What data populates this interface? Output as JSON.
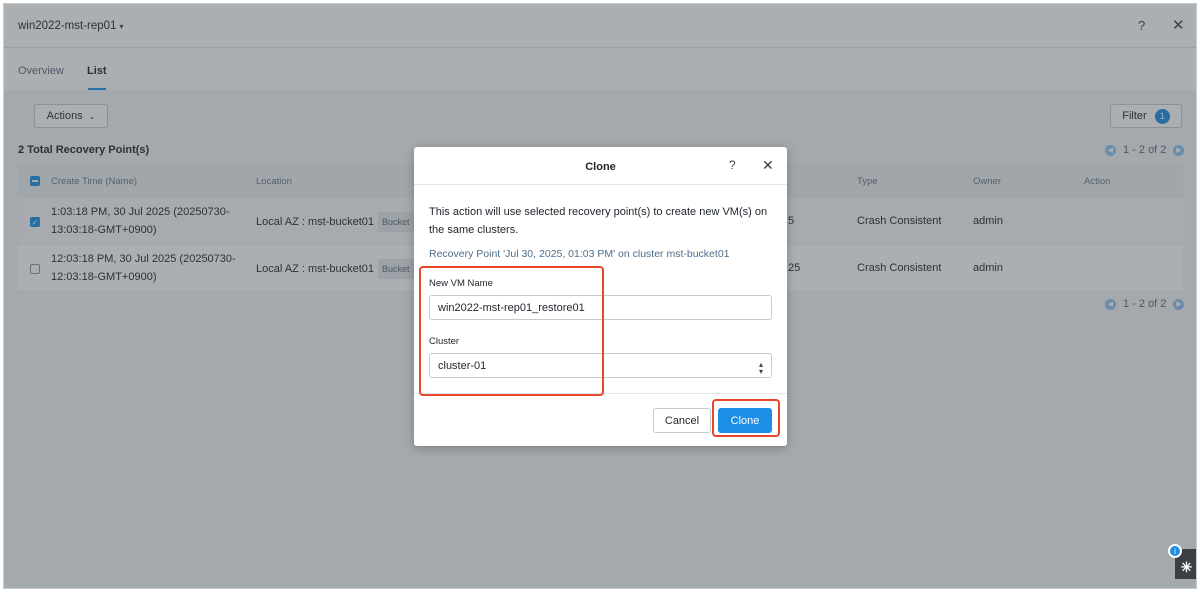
{
  "header": {
    "vm_name": "win2022-mst-rep01",
    "chevron": "▾",
    "help": "?",
    "close": "✕"
  },
  "tabs": [
    {
      "label": "Overview",
      "active": false
    },
    {
      "label": "List",
      "active": true
    }
  ],
  "toolbar": {
    "actions_label": "Actions",
    "actions_chevron": "⌄",
    "filter_label": "Filter",
    "filter_count": "1"
  },
  "list": {
    "total_label": "2 Total Recovery Point(s)",
    "pagination": "1 - 2 of 2",
    "prev_icon": "◀",
    "next_icon": "▶",
    "columns": [
      "Create Time (Name)",
      "Location",
      "Type",
      "Owner",
      "Action"
    ],
    "rows": [
      {
        "selected": true,
        "create_time_line1": "1:03:18 PM, 30 Jul 2025 (20250730-",
        "create_time_line2": "13:03:18-GMT+0900)",
        "location": "Local AZ : mst-bucket01",
        "location_tag": "Bucket",
        "hidden_col_fragment": "5",
        "type": "Crash Consistent",
        "owner": "admin"
      },
      {
        "selected": false,
        "create_time_line1": "12:03:18 PM, 30 Jul 2025 (20250730-",
        "create_time_line2": "12:03:18-GMT+0900)",
        "location": "Local AZ : mst-bucket01",
        "location_tag": "Bucket",
        "hidden_col_fragment": "25",
        "type": "Crash Consistent",
        "owner": "admin"
      }
    ]
  },
  "clone_dialog": {
    "title": "Clone",
    "help": "?",
    "close": "✕",
    "description": "This action will use selected recovery point(s) to create new VM(s) on the same clusters.",
    "recovery_point": "Recovery Point 'Jul 30, 2025, 01:03 PM' on cluster mst-bucket01",
    "vm_name_label": "New VM Name",
    "vm_name_value": "win2022-mst-rep01_restore01",
    "cluster_label": "Cluster",
    "cluster_value": "cluster-01",
    "cancel_label": "Cancel",
    "clone_label": "Clone"
  },
  "widget": {
    "badge": "i",
    "icon": "✳"
  },
  "colors": {
    "accent": "#1b8fe6",
    "highlight": "#e8452b"
  }
}
